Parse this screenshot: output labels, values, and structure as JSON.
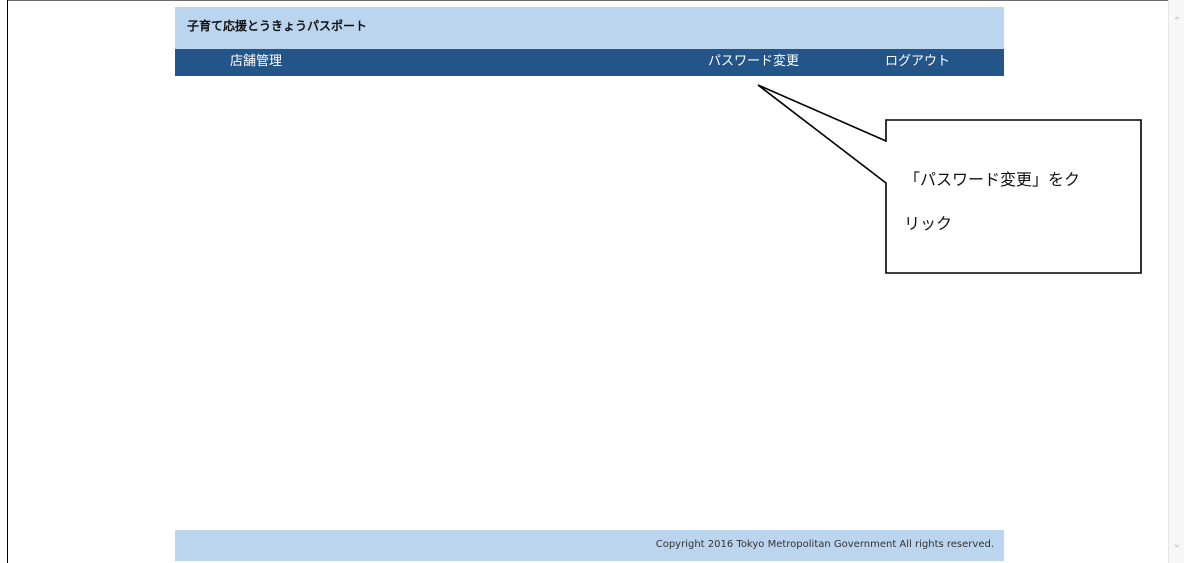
{
  "header": {
    "app_title": "子育て応援とうきょうパスポート"
  },
  "nav": {
    "store_management": "店舗管理",
    "password_change": "パスワード変更",
    "logout": "ログアウト"
  },
  "footer": {
    "copyright": "Copyright 2016 Tokyo Metropolitan Government All rights reserved."
  },
  "annotation": {
    "callout_line1": "「パスワード変更」をク",
    "callout_line2": "リック"
  },
  "colors": {
    "header_bg": "#bcd5ee",
    "nav_bg": "#245589",
    "nav_text": "#ffffff",
    "footer_bg": "#bcd5ee"
  },
  "icons": {
    "scroll_up": "chevron-up-icon",
    "scroll_down": "chevron-down-icon"
  }
}
